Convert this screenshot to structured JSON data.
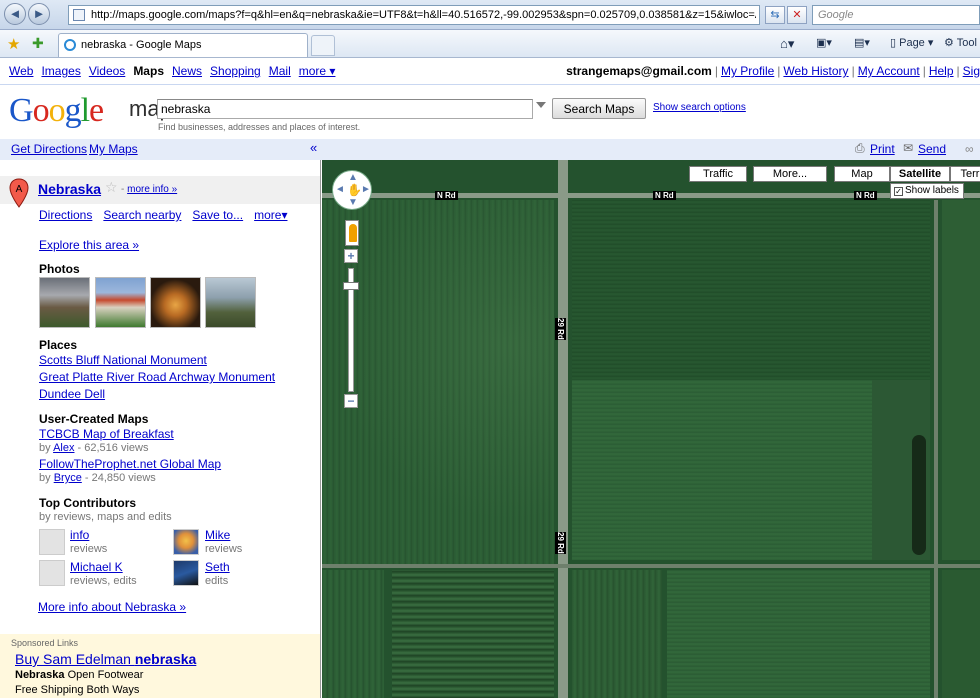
{
  "browser": {
    "url": "http://maps.google.com/maps?f=q&hl=en&q=nebraska&ie=UTF8&t=h&ll=40.516572,-99.002953&spn=0.025709,0.038581&z=15&iwloc=A",
    "search_placeholder": "Google",
    "tab_title": "nebraska - Google Maps",
    "tools": {
      "page": "Page",
      "tools": "Tool"
    },
    "back_glyph": "◄",
    "forward_glyph": "►"
  },
  "gbar": {
    "items": [
      "Web",
      "Images",
      "Videos",
      "Maps",
      "News",
      "Shopping",
      "Mail",
      "more ▾"
    ],
    "active": "Maps",
    "email": "strangemaps@gmail.com",
    "links": [
      "My Profile",
      "Web History",
      "My Account",
      "Help",
      "Sig"
    ]
  },
  "header": {
    "logo_maps": "maps",
    "query": "nebraska",
    "search_button": "Search Maps",
    "show_options": "Show search options",
    "hint": "Find businesses, addresses and places of interest."
  },
  "toolbar": {
    "get_directions": "Get Directions",
    "my_maps": "My Maps",
    "collapse": "«",
    "print": "Print",
    "send": "Send",
    "link": "∞"
  },
  "result": {
    "marker_letter": "A",
    "title": "Nebraska",
    "more_info": "more info »",
    "actions": [
      "Directions",
      "Search nearby",
      "Save to...",
      "more▾"
    ],
    "explore": "Explore this area »"
  },
  "photos": {
    "title": "Photos"
  },
  "places": {
    "title": "Places",
    "items": [
      "Scotts Bluff National Monument",
      "Great Platte River Road Archway Monument",
      "Dundee Dell"
    ]
  },
  "user_maps": {
    "title": "User-Created Maps",
    "items": [
      {
        "name": "TCBCB Map of Breakfast",
        "by": "by",
        "author": "Alex",
        "views": " - 62,516 views"
      },
      {
        "name": "FollowTheProphet.net Global Map",
        "by": "by",
        "author": "Bryce",
        "views": " - 24,850 views"
      }
    ]
  },
  "contributors": {
    "title": "Top Contributors",
    "subtitle": "by reviews, maps and edits",
    "items": [
      {
        "name": "info",
        "detail": "reviews"
      },
      {
        "name": "Mike",
        "detail": "reviews"
      },
      {
        "name": "Michael K",
        "detail": "reviews, edits"
      },
      {
        "name": "Seth",
        "detail": "edits"
      }
    ]
  },
  "more_about": "More info about Nebraska »",
  "sponsored": {
    "title": "Sponsored Links",
    "ad_title_plain": "Buy Sam Edelman ",
    "ad_title_bold": "nebraska",
    "ad_line1_bold": "Nebraska",
    "ad_line1_rest": " Open Footwear",
    "ad_line2": "Free Shipping Both Ways"
  },
  "map": {
    "road_h": "N Rd",
    "road_v": "29 Rd",
    "types": [
      "Traffic",
      "More...",
      "Map",
      "Satellite",
      "Terr"
    ],
    "active_type": "Satellite",
    "show_labels": "Show labels",
    "checkbox": "✓",
    "zoom_in": "+",
    "zoom_out": "−"
  }
}
